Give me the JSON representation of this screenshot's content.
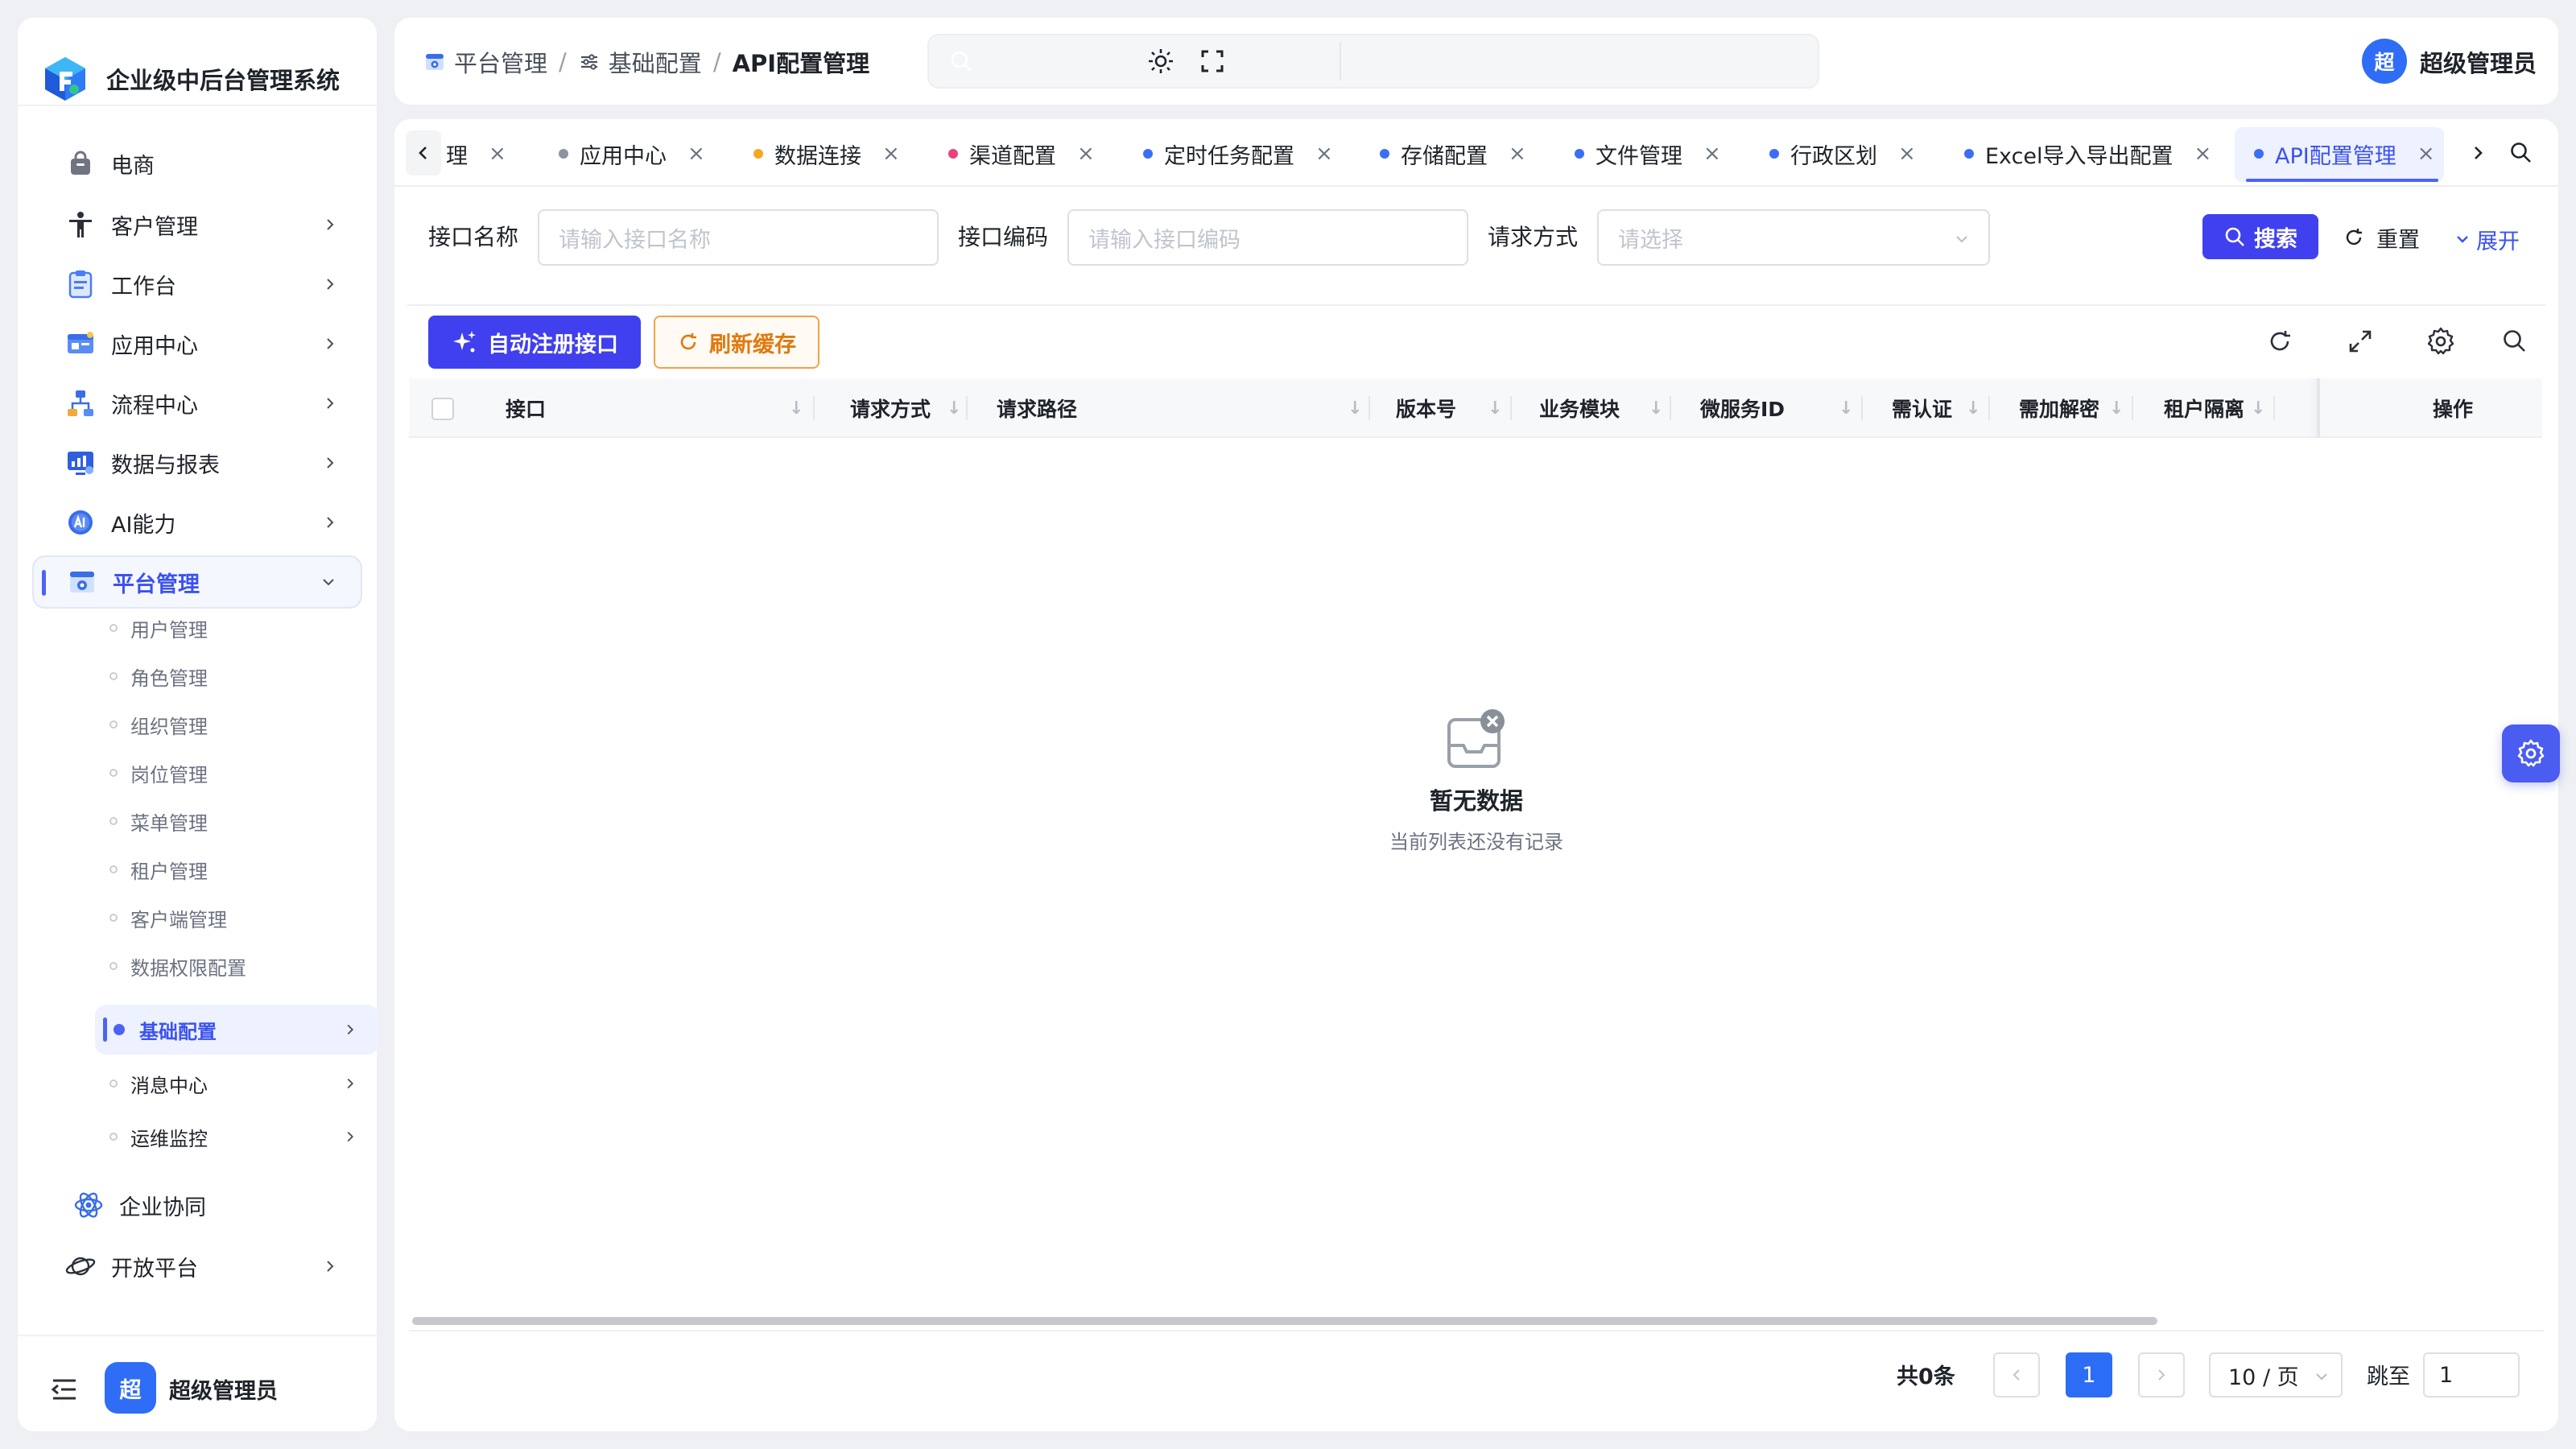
{
  "app": {
    "title": "企业级中后台管理系统"
  },
  "sidebar": {
    "menu": [
      {
        "label": "电商"
      },
      {
        "label": "客户管理"
      },
      {
        "label": "工作台"
      },
      {
        "label": "应用中心"
      },
      {
        "label": "流程中心"
      },
      {
        "label": "数据与报表"
      },
      {
        "label": "AI能力"
      },
      {
        "label": "平台管理"
      },
      {
        "label": "企业协同"
      },
      {
        "label": "开放平台"
      }
    ],
    "submenu": [
      {
        "label": "用户管理"
      },
      {
        "label": "角色管理"
      },
      {
        "label": "组织管理"
      },
      {
        "label": "岗位管理"
      },
      {
        "label": "菜单管理"
      },
      {
        "label": "租户管理"
      },
      {
        "label": "客户端管理"
      },
      {
        "label": "数据权限配置"
      },
      {
        "label": "基础配置"
      },
      {
        "label": "消息中心"
      },
      {
        "label": "运维监控"
      }
    ],
    "footer": {
      "avatar_char": "超",
      "user": "超级管理员"
    }
  },
  "header": {
    "breadcrumb": [
      "平台管理",
      "基础配置",
      "API配置管理"
    ],
    "sep": "/",
    "user": {
      "avatar_char": "超",
      "name": "超级管理员"
    }
  },
  "tabs": [
    {
      "label": "理",
      "dot": ""
    },
    {
      "label": "应用中心",
      "dot": "#8c93a0"
    },
    {
      "label": "数据连接",
      "dot": "#f5a623"
    },
    {
      "label": "渠道配置",
      "dot": "#e8437a"
    },
    {
      "label": "定时任务配置",
      "dot": "#3b6ef5"
    },
    {
      "label": "存储配置",
      "dot": "#3b6ef5"
    },
    {
      "label": "文件管理",
      "dot": "#3b6ef5"
    },
    {
      "label": "行政区划",
      "dot": "#3b6ef5"
    },
    {
      "label": "Excel导入导出配置",
      "dot": "#3b6ef5"
    },
    {
      "label": "API配置管理",
      "dot": "#3b6ef5"
    }
  ],
  "tab_close": "×",
  "filters": {
    "name_label": "接口名称",
    "name_placeholder": "请输入接口名称",
    "code_label": "接口编码",
    "code_placeholder": "请输入接口编码",
    "method_label": "请求方式",
    "method_placeholder": "请选择",
    "search_btn": "搜索",
    "reset_btn": "重置",
    "expand_btn": "展开"
  },
  "toolbar": {
    "auto_register": "自动注册接口",
    "refresh_cache": "刷新缓存"
  },
  "table": {
    "columns": [
      "接口",
      "请求方式",
      "请求路径",
      "版本号",
      "业务模块",
      "微服务ID",
      "需认证",
      "需加解密",
      "租户隔离",
      "操作"
    ],
    "empty_title": "暂无数据",
    "empty_sub": "当前列表还没有记录"
  },
  "pagination": {
    "total": "共0条",
    "current": "1",
    "page_size": "10 / 页",
    "jump_label": "跳至",
    "jump_value": "1"
  },
  "colors": {
    "primary": "#4040ef",
    "accent": "#3b52ee",
    "warning": "#e07a10",
    "page_active": "#2d6df6"
  }
}
